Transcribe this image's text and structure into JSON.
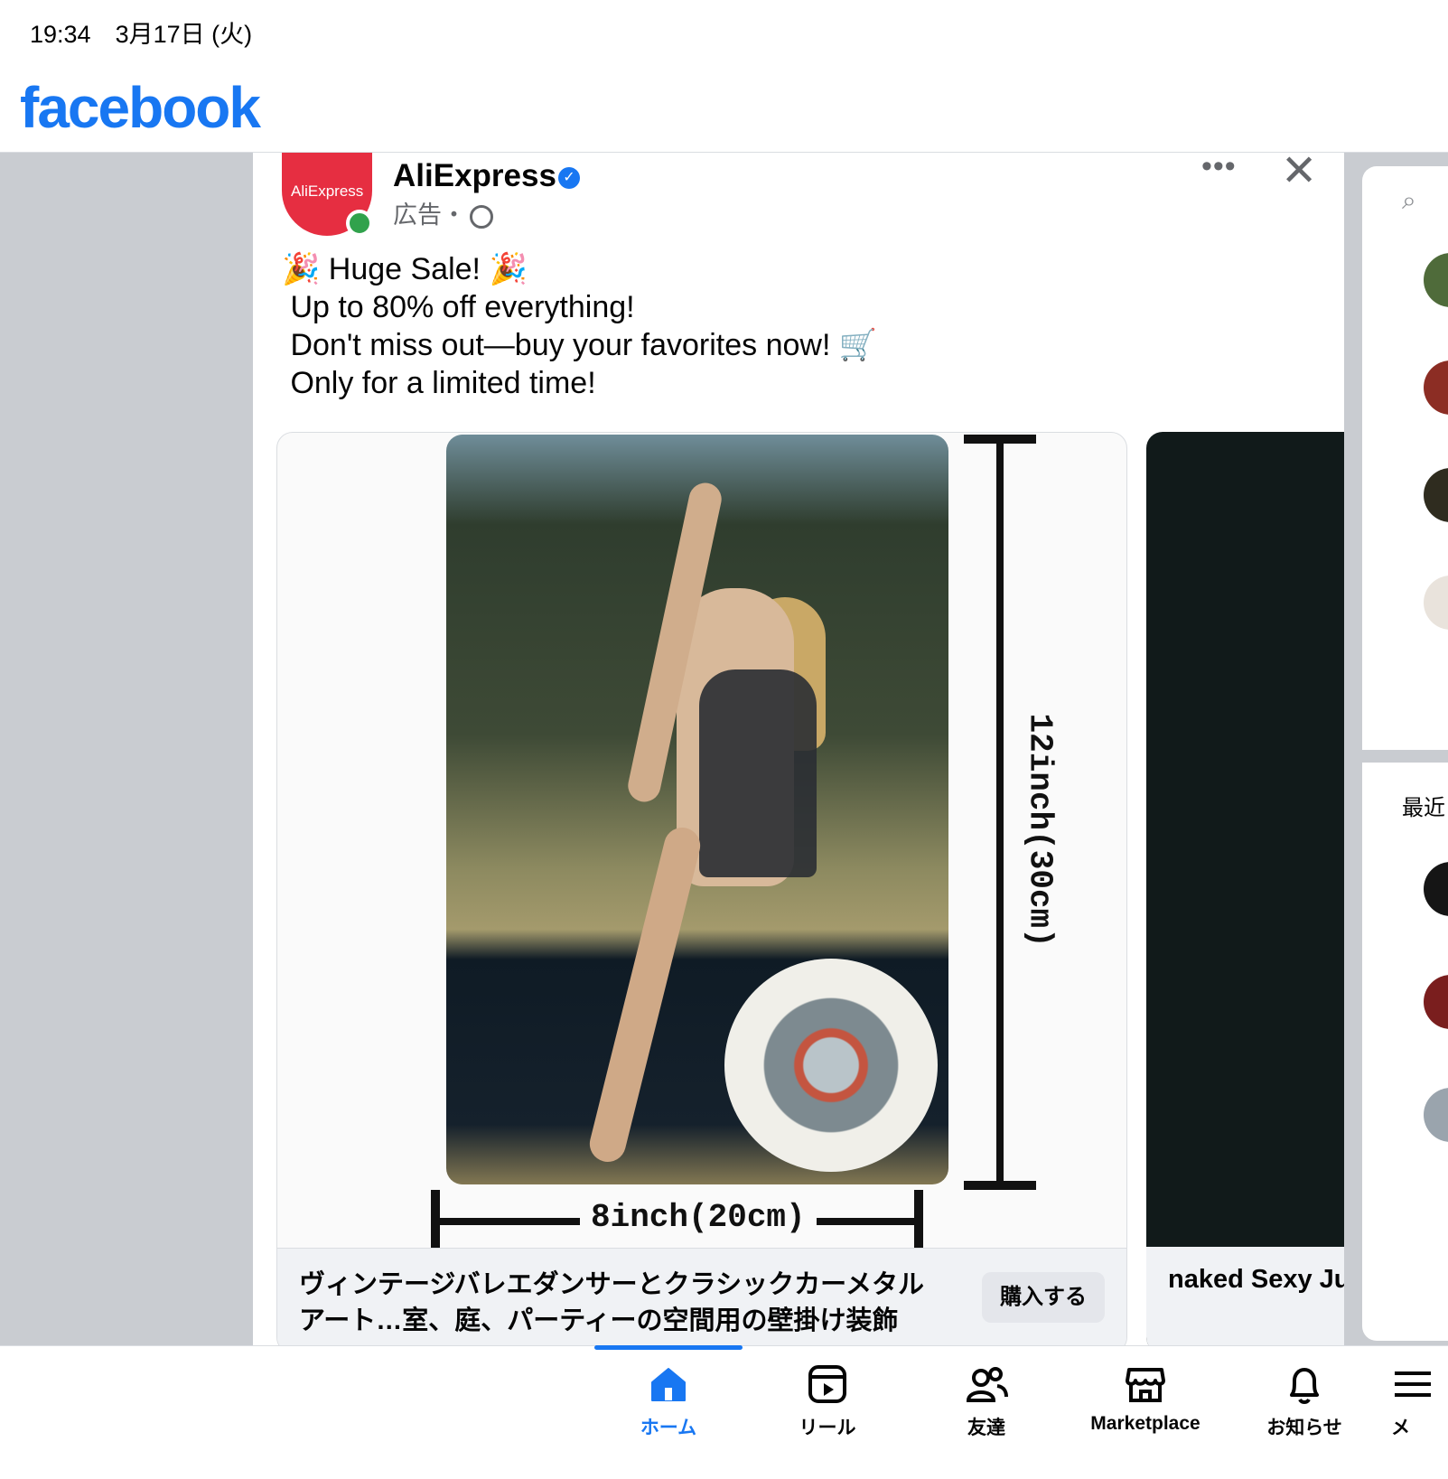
{
  "status_bar": {
    "time_date": "19:34　3月17日 (火)"
  },
  "header": {
    "logo": "facebook"
  },
  "post": {
    "page_name": "AliExpress",
    "avatar_text": "AliExpress",
    "meta": "広告・",
    "text": "🎉 Huge Sale! 🎉\n Up to 80% off everything!\n Don't miss out—buy your favorites now! 🛒\n Only for a limited time!",
    "card1": {
      "height_label": "12inch(30cm)",
      "width_label": "8inch(20cm)",
      "caption": "ヴィンテージバレエダンサーとクラシックカーメタルアート…室、庭、パーティーの空間用の壁掛け装飾",
      "button": "購入する"
    },
    "card2": {
      "caption": "naked Sexy Ju…"
    }
  },
  "sidebar": {
    "recent_label": "最近"
  },
  "bottom_nav": [
    {
      "label": "ホーム",
      "icon": "home-icon",
      "active": true
    },
    {
      "label": "リール",
      "icon": "reels-icon"
    },
    {
      "label": "友達",
      "icon": "friends-icon"
    },
    {
      "label": "Marketplace",
      "icon": "marketplace-icon"
    },
    {
      "label": "お知らせ",
      "icon": "bell-icon"
    },
    {
      "label": "メ",
      "icon": "menu-icon"
    }
  ],
  "colors": {
    "brand": "#1877f2",
    "aliexpress": "#e62e41"
  }
}
